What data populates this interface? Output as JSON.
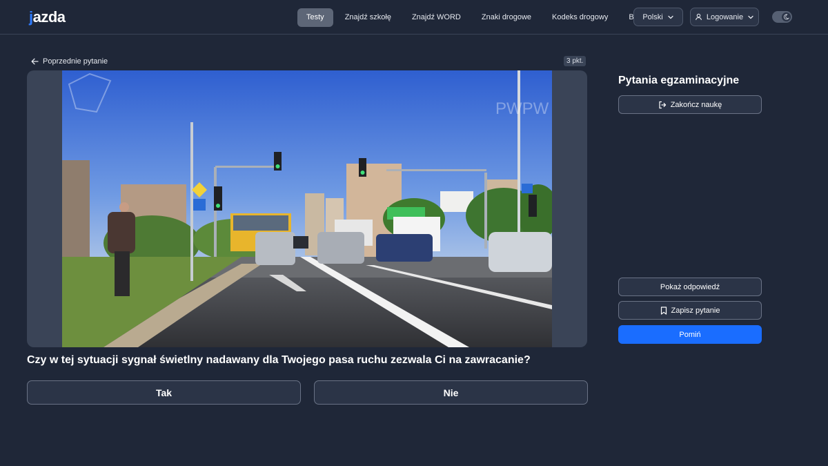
{
  "header": {
    "logo_prefix": "j",
    "logo_rest": "azda",
    "nav": [
      "Testy",
      "Znajdź szkołę",
      "Znajdź WORD",
      "Znaki drogowe",
      "Kodeks drogowy",
      "Blog"
    ],
    "active_nav": "Testy",
    "language": "Polski",
    "login": "Logowanie",
    "icons": {
      "language_caret": "chevron-down-icon",
      "login": "user-icon",
      "login_caret": "chevron-down-icon",
      "theme": "moon-icon"
    }
  },
  "question": {
    "prev_label": "Poprzednie pytanie",
    "points": "3 pkt.",
    "text": "Czy w tej sytuacji sygnał świetlny nadawany dla Twojego pasa ruchu zezwala Ci na zawracanie?",
    "answers": [
      "Tak",
      "Nie"
    ],
    "photo_watermark": "PWPW"
  },
  "sidebar": {
    "title": "Pytania egzaminacyjne",
    "finish_label": "Zakończ naukę",
    "show_answer_label": "Pokaż odpowiedź",
    "save_label": "Zapisz pytanie",
    "skip_label": "Pomiń"
  },
  "colors": {
    "background": "#1f2738",
    "accent": "#1a6dff",
    "logo_accent": "#2f7cff",
    "panel": "#3a4457"
  }
}
